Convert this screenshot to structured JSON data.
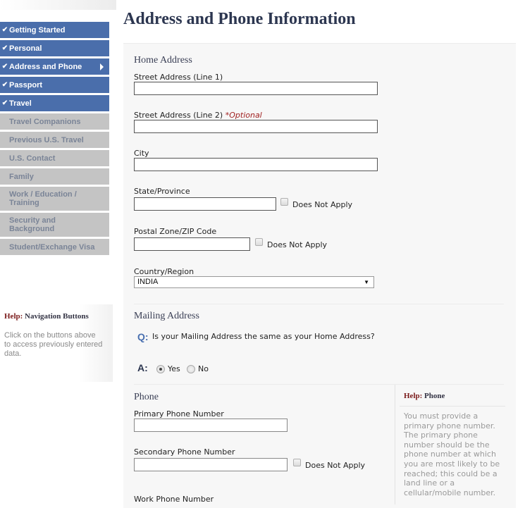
{
  "nav": {
    "completed": [
      {
        "label": "Getting Started",
        "current": false
      },
      {
        "label": "Personal",
        "current": false
      },
      {
        "label": "Address and Phone",
        "current": true
      },
      {
        "label": "Passport",
        "current": false
      },
      {
        "label": "Travel",
        "current": false
      }
    ],
    "pending": [
      {
        "label": "Travel Companions"
      },
      {
        "label": "Previous U.S. Travel"
      },
      {
        "label": "U.S. Contact"
      },
      {
        "label": "Family"
      },
      {
        "label": "Work / Education / Training"
      },
      {
        "label": "Security and Background"
      },
      {
        "label": "Student/Exchange Visa"
      }
    ],
    "check_icon": "checkmark-icon",
    "current_icon": "triangle-right-icon",
    "colors": {
      "completed_bg": "#4a6eab",
      "pending_bg": "#c4c4c4",
      "pending_text": "#7a8497"
    }
  },
  "help_nav": {
    "key": "Help:",
    "title": "Navigation Buttons",
    "body": "Click on the buttons above to access previously entered data."
  },
  "page": {
    "title": "Address and Phone Information"
  },
  "home_address": {
    "section_title": "Home Address",
    "street1": {
      "label": "Street Address (Line 1)",
      "value": ""
    },
    "street2": {
      "label": "Street Address (Line 2)",
      "optional": "*Optional",
      "value": ""
    },
    "city": {
      "label": "City",
      "value": ""
    },
    "state": {
      "label": "State/Province",
      "value": "",
      "dna_label": "Does Not Apply",
      "dna_checked": false
    },
    "postal": {
      "label": "Postal Zone/ZIP Code",
      "value": "",
      "dna_label": "Does Not Apply",
      "dna_checked": false
    },
    "country": {
      "label": "Country/Region",
      "selected": "INDIA"
    }
  },
  "mailing_address": {
    "section_title": "Mailing Address",
    "q_marker": "Q:",
    "question": "Is your Mailing Address the same as your Home Address?",
    "a_marker": "A:",
    "options": [
      {
        "label": "Yes",
        "selected": true
      },
      {
        "label": "No",
        "selected": false
      }
    ]
  },
  "phone": {
    "section_title": "Phone",
    "primary": {
      "label": "Primary Phone Number",
      "value": ""
    },
    "secondary": {
      "label": "Secondary Phone Number",
      "value": "",
      "dna_label": "Does Not Apply",
      "dna_checked": false
    },
    "cut_off_label": "Work Phone Number"
  },
  "help_phone": {
    "key": "Help:",
    "title": "Phone",
    "body": "You must provide a primary phone number. The primary phone number should be the phone number at which you are most likely to be reached; this could be a land line or a cellular/mobile number."
  }
}
